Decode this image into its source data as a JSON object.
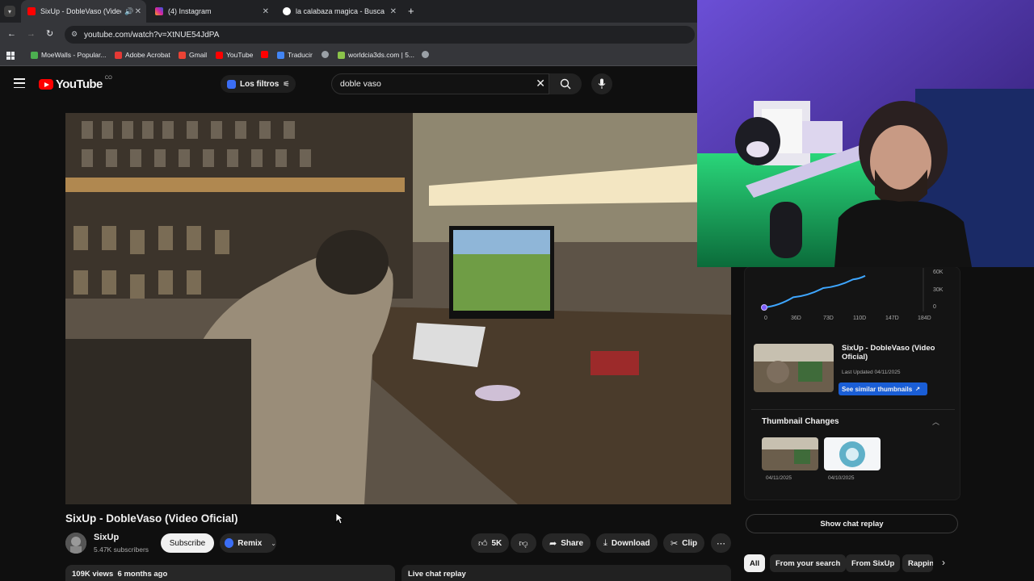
{
  "browser": {
    "tabs": [
      {
        "title": "SixUp - DobleVaso (Video O",
        "active": true
      },
      {
        "title": "(4) Instagram",
        "active": false
      },
      {
        "title": "la calabaza magica - Buscar co",
        "active": false
      }
    ],
    "url": "youtube.com/watch?v=XtNUE54JdPA",
    "bookmarks": [
      "MoeWalls - Popular...",
      "Adobe Acrobat",
      "Gmail",
      "YouTube",
      "Traducir",
      "worldcia3ds.com | 5..."
    ]
  },
  "header": {
    "logo": "YouTube",
    "country": "CO",
    "filters_label": "Los filtros",
    "search_value": "doble vaso"
  },
  "video": {
    "title": "SixUp - DobleVaso (Video Oficial)",
    "channel": "SixUp",
    "subscribers": "5.47K subscribers",
    "subscribe_label": "Subscribe",
    "remix_label": "Remix",
    "likes": "5K",
    "share_label": "Share",
    "download_label": "Download",
    "clip_label": "Clip",
    "views": "109K views",
    "age": "6 months ago",
    "live_chat_label": "Live chat replay"
  },
  "panel": {
    "chart_data": {
      "type": "line",
      "x_ticks": [
        "0",
        "36D",
        "73D",
        "110D",
        "147D",
        "184D"
      ],
      "y_ticks": [
        "60K",
        "30K",
        "0"
      ],
      "points": [
        [
          0,
          0
        ],
        [
          36,
          20000
        ],
        [
          73,
          38000
        ],
        [
          110,
          55000
        ],
        [
          125,
          62000
        ]
      ],
      "xlim": [
        0,
        184
      ],
      "ylim": [
        0,
        68000
      ],
      "line_color": "#3ea6ff"
    },
    "thumb_title": "SixUp - DobleVaso (Video Oficial)",
    "last_updated": "Last Updated 04/11/2025",
    "similar_label": "See similar thumbnails",
    "changes_title": "Thumbnail Changes",
    "change_dates": [
      "04/11/2025",
      "04/10/2025"
    ]
  },
  "sidebar": {
    "show_chat_label": "Show chat replay",
    "chips": [
      "All",
      "From your search",
      "From SixUp",
      "Rappin"
    ]
  }
}
